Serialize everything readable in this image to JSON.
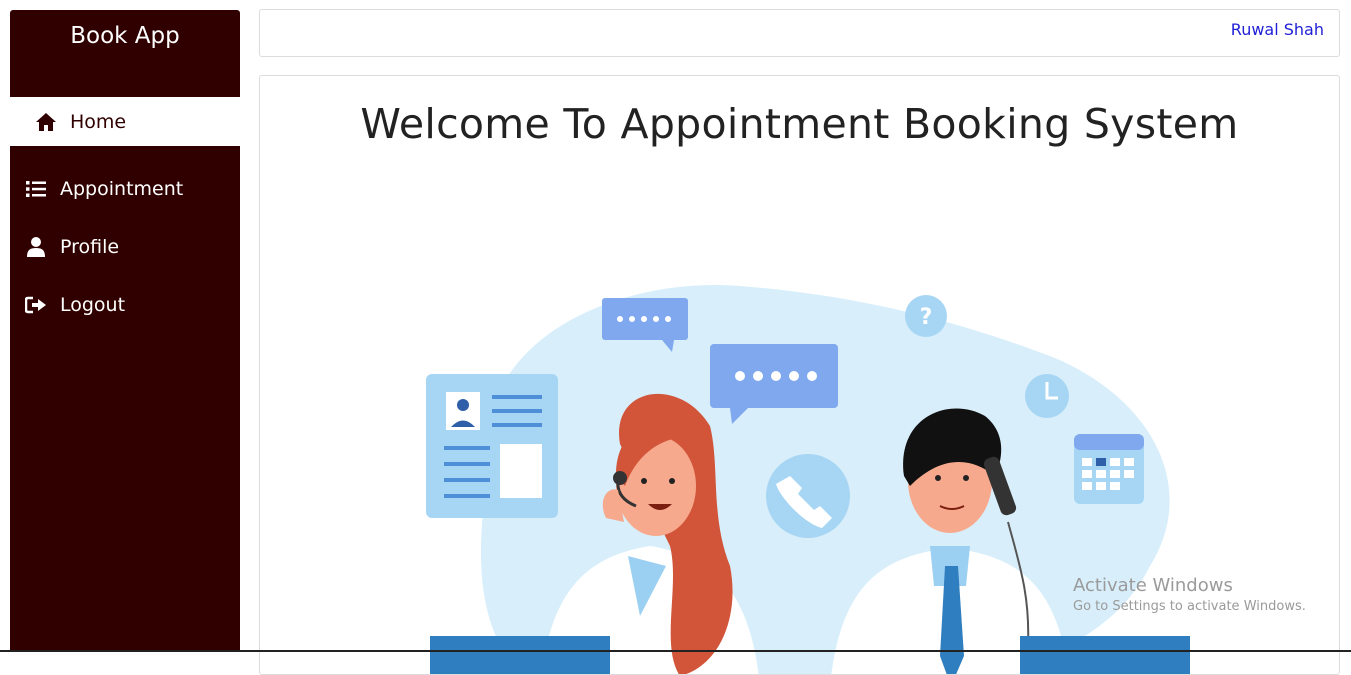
{
  "sidebar": {
    "brand": "Book App",
    "items": [
      {
        "label": "Home",
        "icon": "home-icon",
        "active": true
      },
      {
        "label": "Appointment",
        "icon": "list-icon",
        "active": false
      },
      {
        "label": "Profile",
        "icon": "user-icon",
        "active": false
      },
      {
        "label": "Logout",
        "icon": "logout-icon",
        "active": false
      }
    ]
  },
  "header": {
    "user_name": "Ruwal Shah"
  },
  "main": {
    "title": "Welcome To Appointment Booking System"
  },
  "watermark": {
    "line1": "Activate Windows",
    "line2": "Go to Settings to activate Windows."
  },
  "colors": {
    "sidebar_bg": "#300000",
    "link": "#1f1fd6"
  }
}
